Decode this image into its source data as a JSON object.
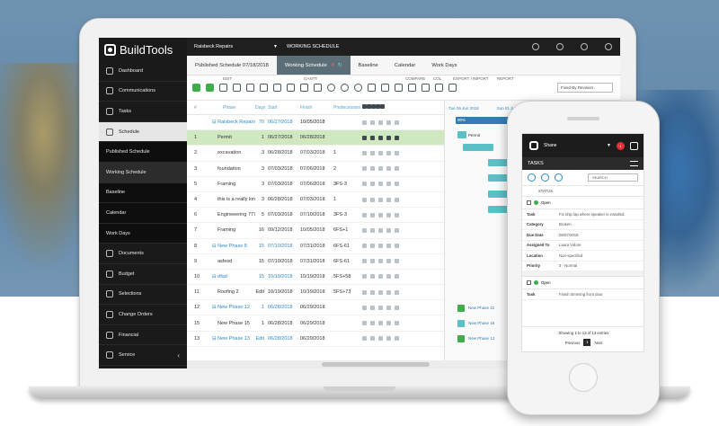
{
  "app": {
    "logo": "BuildTools"
  },
  "sidebar": {
    "items": [
      {
        "label": "Dashboard",
        "icon": "gauge-icon"
      },
      {
        "label": "Communications",
        "icon": "chat-icon"
      },
      {
        "label": "Tasks",
        "icon": "checklist-icon"
      },
      {
        "label": "Schedule",
        "icon": "calendar-icon"
      }
    ],
    "subitems": [
      "Published Schedule",
      "Working Schedule",
      "Baseline",
      "Calendar",
      "Work Days"
    ],
    "items2": [
      {
        "label": "Documents",
        "icon": "document-icon"
      },
      {
        "label": "Budget",
        "icon": "dollar-icon"
      },
      {
        "label": "Selections",
        "icon": "selection-icon"
      },
      {
        "label": "Change Orders",
        "icon": "swap-icon"
      },
      {
        "label": "Financial",
        "icon": "bank-icon"
      },
      {
        "label": "Service",
        "icon": "wrench-icon"
      }
    ],
    "collapse": "‹"
  },
  "topbar": {
    "project": "Raisbeck Repairs",
    "section": "WORKING SCHEDULE"
  },
  "tabs": [
    "Published Schedule 07/18/2018",
    "Working Schedule",
    "Baseline",
    "Calendar",
    "Work Days"
  ],
  "toolbar": {
    "edit": "EDIT",
    "gantt": "GANTT",
    "compare": "COMPARE",
    "col": "COL",
    "export": "EXPORT / IMPORT",
    "report": "REPORT",
    "fixed": "Fixed By Revision"
  },
  "grid": {
    "headers": [
      "#",
      "Phase",
      "Days",
      "Start",
      "Finish",
      "Predecessors"
    ],
    "rows": [
      {
        "num": "",
        "phase": "⊟ Raisbeck Repairs",
        "days": "70",
        "start": "06/27/2018",
        "finish": "10/05/2018",
        "pred": "",
        "kind": "summary"
      },
      {
        "num": "1",
        "phase": "Permit",
        "days": "1",
        "start": "06/27/2018",
        "finish": "06/28/2018",
        "pred": "",
        "kind": "selected"
      },
      {
        "num": "2",
        "phase": "excavation",
        "days": "3",
        "start": "06/28/2018",
        "finish": "07/03/2018",
        "pred": "1",
        "kind": "task"
      },
      {
        "num": "3",
        "phase": "foundation",
        "days": "3",
        "start": "07/03/2018",
        "finish": "07/06/2018",
        "pred": "2",
        "kind": "task"
      },
      {
        "num": "5",
        "phase": "Framing",
        "days": "3",
        "start": "07/03/2018",
        "finish": "07/06/2018",
        "pred": "3FS-3",
        "kind": "task"
      },
      {
        "num": "4",
        "phase": "this is a really long p",
        "days": "3",
        "start": "06/28/2018",
        "finish": "07/03/2018",
        "pred": "1",
        "kind": "task"
      },
      {
        "num": "6",
        "phase": "Engineeering 777p",
        "days": "5",
        "start": "07/03/2018",
        "finish": "07/10/2018",
        "pred": "3FS-3",
        "kind": "task"
      },
      {
        "num": "7",
        "phase": "Framing",
        "days": "16",
        "start": "09/12/2018",
        "finish": "10/05/2018",
        "pred": "6FS+1",
        "kind": "task"
      },
      {
        "num": "8",
        "phase": "⊟ New Phase 8",
        "days": "15",
        "start": "07/10/2018",
        "finish": "07/31/2018",
        "pred": "6FS-61",
        "kind": "phase"
      },
      {
        "num": "9",
        "phase": "asfesd",
        "days": "15",
        "start": "07/10/2018",
        "finish": "07/31/2018",
        "pred": "6FS-61",
        "kind": "task"
      },
      {
        "num": "10",
        "phase": "⊟ dfad",
        "days": "15",
        "start": "10/19/2018",
        "finish": "10/19/2018",
        "pred": "5FS+58",
        "kind": "phase"
      },
      {
        "num": "11",
        "phase": "Roofing 2",
        "days": "Edit",
        "start": "10/19/2018",
        "finish": "10/19/2018",
        "pred": "5FS+73",
        "kind": "task"
      },
      {
        "num": "12",
        "phase": "⊟ New Phase 12",
        "days": "1",
        "start": "06/28/2018",
        "finish": "06/29/2018",
        "pred": "",
        "kind": "phase"
      },
      {
        "num": "15",
        "phase": "New Phase 15",
        "days": "1",
        "start": "06/28/2018",
        "finish": "06/29/2018",
        "pred": "",
        "kind": "task"
      },
      {
        "num": "13",
        "phase": "⊟ New Phase 13",
        "days": "Edit",
        "start": "06/28/2018",
        "finish": "06/29/2018",
        "pred": "",
        "kind": "phase"
      }
    ]
  },
  "gantt": {
    "head_left": "Tue 26 Jun 2018",
    "head_right": "Sun 01 Jul 2018",
    "pct": "90%",
    "permit_label": "Permit",
    "labels": [
      "New Phase 12",
      "New Phase 15",
      "New Phase 13"
    ]
  },
  "phone": {
    "user": "Shane",
    "badge": "1",
    "title": "TASKS",
    "search": "SEARCH",
    "status_header": "STATUS",
    "record1": {
      "status": "Open",
      "fields": [
        {
          "k": "Task",
          "v": "Fix ship lap where speaker is installed."
        },
        {
          "k": "Category",
          "v": "Broken"
        },
        {
          "k": "Due Date",
          "v": "08/07/2018"
        },
        {
          "k": "Assigned To",
          "v": "Laura Vidore"
        },
        {
          "k": "Location",
          "v": "Non-specified"
        },
        {
          "k": "Priority",
          "v": "3 - Normal"
        }
      ]
    },
    "record2": {
      "status": "Open",
      "fields": [
        {
          "k": "Task",
          "v": "Finish trimming front door"
        }
      ]
    },
    "footer": "Showing 1 to 13 of 13 entries",
    "prev": "Previous",
    "page": "1",
    "next": "Next"
  }
}
